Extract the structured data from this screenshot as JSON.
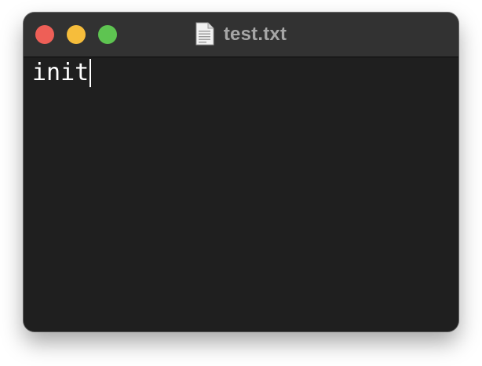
{
  "window": {
    "title": "test.txt",
    "icon": "text-document-icon"
  },
  "traffic_lights": {
    "close": {
      "icon": "close-traffic-light",
      "color": "#ee5f57"
    },
    "minimize": {
      "icon": "minimize-traffic-light",
      "color": "#f6bd3b"
    },
    "zoom": {
      "icon": "zoom-traffic-light",
      "color": "#5ec451"
    }
  },
  "editor": {
    "content": "init",
    "text_color": "#ffffff",
    "background": "#1f1f1f"
  }
}
